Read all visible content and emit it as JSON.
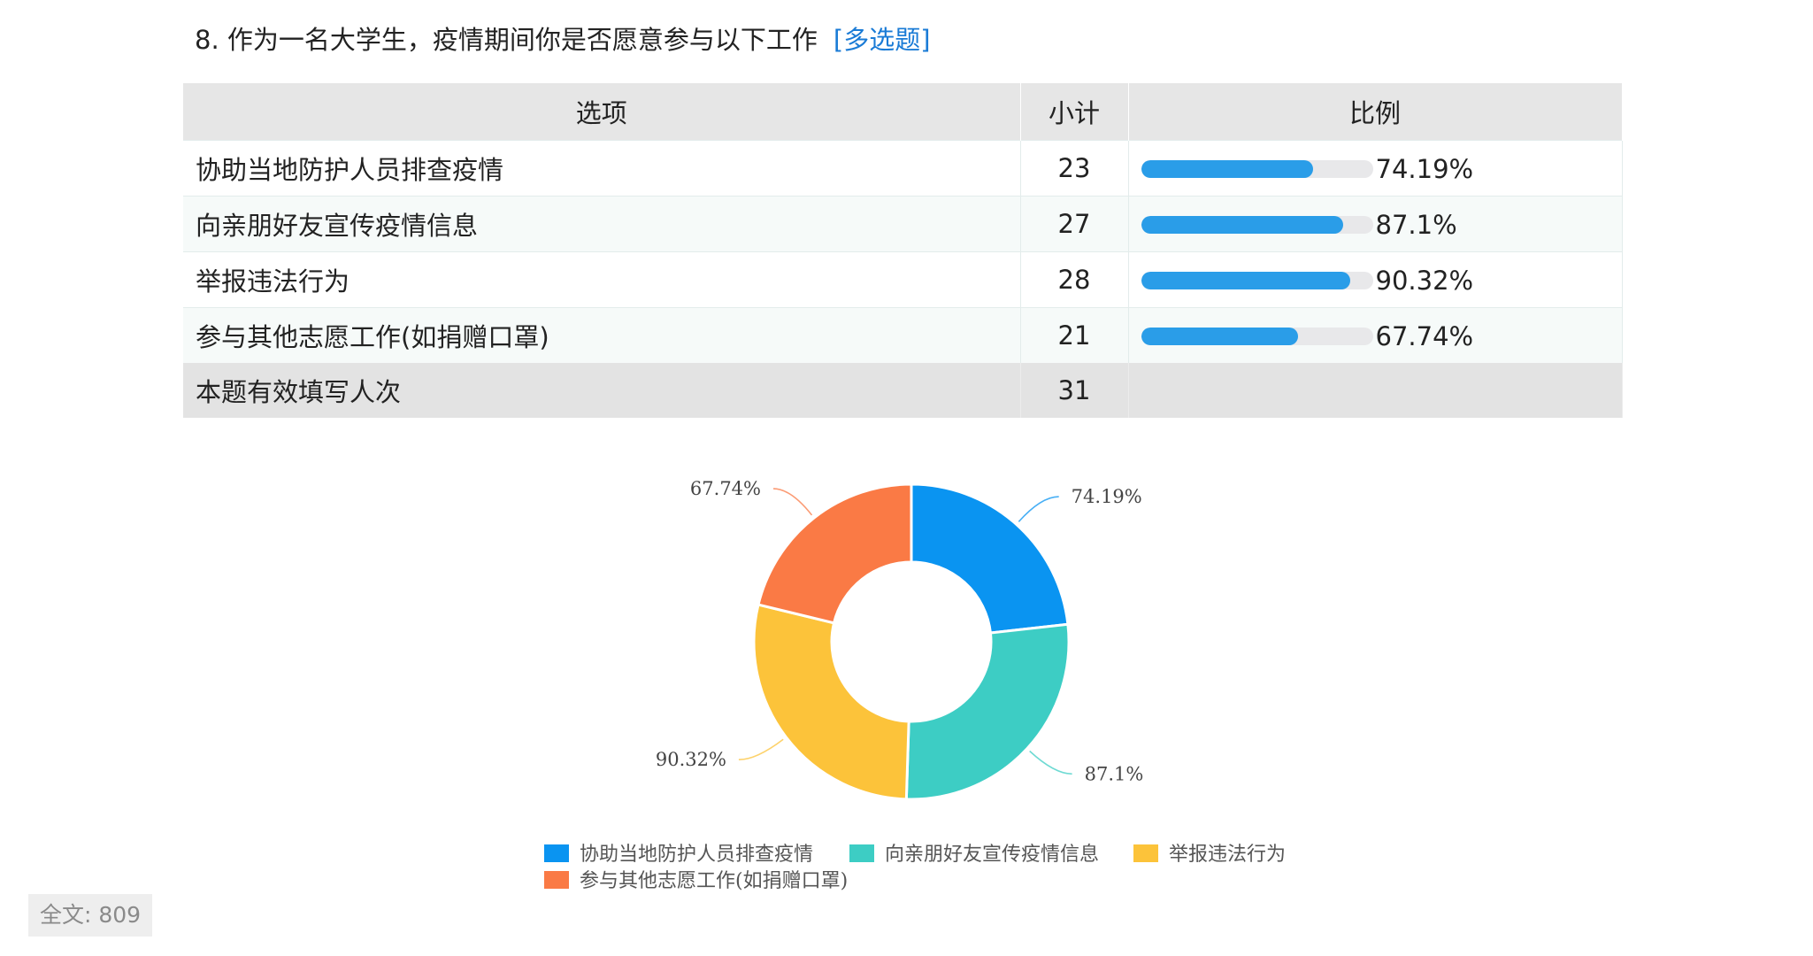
{
  "question": {
    "title": "8. 作为一名大学生，疫情期间你是否愿意参与以下工作",
    "tag": "[多选题]"
  },
  "table": {
    "headers": [
      "选项",
      "小计",
      "比例"
    ],
    "rows": [
      {
        "option": "协助当地防护人员排查疫情",
        "count": "23",
        "percent": "74.19%",
        "ratio": 0.7419
      },
      {
        "option": "向亲朋好友宣传疫情信息",
        "count": "27",
        "percent": "87.1%",
        "ratio": 0.871
      },
      {
        "option": "举报违法行为",
        "count": "28",
        "percent": "90.32%",
        "ratio": 0.9032
      },
      {
        "option": "参与其他志愿工作(如捐赠口罩)",
        "count": "21",
        "percent": "67.74%",
        "ratio": 0.6774
      }
    ],
    "total_label": "本题有效填写人次",
    "total_count": "31"
  },
  "chart_data": {
    "type": "pie",
    "categories": [
      "协助当地防护人员排查疫情",
      "向亲朋好友宣传疫情信息",
      "举报违法行为",
      "参与其他志愿工作(如捐赠口罩)"
    ],
    "values": [
      74.19,
      87.1,
      90.32,
      67.74
    ],
    "labels": [
      "74.19%",
      "87.1%",
      "90.32%",
      "67.74%"
    ],
    "colors": [
      "#0a94f1",
      "#3dcdc4",
      "#fcc33a",
      "#fa7a45"
    ],
    "donut": true,
    "legend_position": "bottom"
  },
  "footer": {
    "word_count": "全文: 809"
  }
}
